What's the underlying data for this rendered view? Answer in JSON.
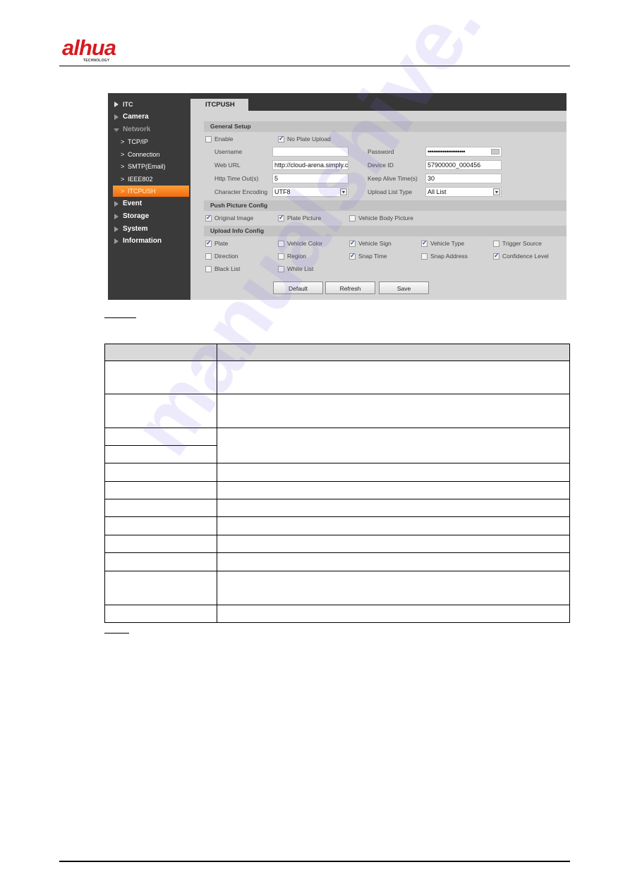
{
  "header": {
    "brand": "alhua",
    "tagline": "TECHNOLOGY",
    "brand_color": "#d7191f"
  },
  "screenshot": {
    "sidebar": {
      "items": [
        {
          "label": "ITC",
          "icon": "triangle-right-icon"
        },
        {
          "label": "Camera",
          "icon": "triangle-right-icon"
        },
        {
          "label": "Network",
          "icon": "triangle-down-icon",
          "expanded": true
        },
        {
          "label": "Event",
          "icon": "triangle-right-icon"
        },
        {
          "label": "Storage",
          "icon": "triangle-right-icon"
        },
        {
          "label": "System",
          "icon": "triangle-right-icon"
        },
        {
          "label": "Information",
          "icon": "triangle-right-icon"
        }
      ],
      "network_children": [
        {
          "label": "TCP/IP",
          "icon": "chevron-right-icon"
        },
        {
          "label": "Connection",
          "icon": "chevron-right-icon"
        },
        {
          "label": "SMTP(Email)",
          "icon": "chevron-right-icon"
        },
        {
          "label": "IEEE802",
          "icon": "chevron-right-icon"
        },
        {
          "label": "ITCPUSH",
          "icon": "chevron-right-icon",
          "active": true
        }
      ],
      "active_color": "#f58220"
    },
    "tab": "ITCPUSH",
    "general": {
      "title": "General Setup",
      "enable": {
        "label": "Enable",
        "checked": false
      },
      "no_plate_upload": {
        "label": "No Plate Upload",
        "checked": true
      },
      "username": {
        "label": "Username",
        "value": ""
      },
      "password": {
        "label": "Password",
        "value": "••••••••••••••••••••"
      },
      "web_url": {
        "label": "Web URL",
        "value": "http://cloud-arena.simply.c"
      },
      "device_id": {
        "label": "Device ID",
        "value": "57900000_000456"
      },
      "http_timeout": {
        "label": "Http Time Out(s)",
        "value": "5"
      },
      "keep_alive": {
        "label": "Keep Alive Time(s)",
        "value": "30"
      },
      "char_encoding": {
        "label": "Character Encoding",
        "value": "UTF8"
      },
      "upload_list_type": {
        "label": "Upload List Type",
        "value": "All List"
      }
    },
    "push_picture": {
      "title": "Push Picture Config",
      "items": [
        {
          "label": "Original Image",
          "checked": true
        },
        {
          "label": "Plate Picture",
          "checked": true
        },
        {
          "label": "Vehicle Body Picture",
          "checked": false
        }
      ]
    },
    "upload_info": {
      "title": "Upload Info Config",
      "items": [
        {
          "label": "Plate",
          "checked": true
        },
        {
          "label": "Vehicle Color",
          "checked": false
        },
        {
          "label": "Vehicle Sign",
          "checked": true
        },
        {
          "label": "Vehicle Type",
          "checked": true
        },
        {
          "label": "Trigger Source",
          "checked": false
        },
        {
          "label": "Direction",
          "checked": false
        },
        {
          "label": "Region",
          "checked": false
        },
        {
          "label": "Snap Time",
          "checked": true
        },
        {
          "label": "Snap Address",
          "checked": false
        },
        {
          "label": "Confidence Level",
          "checked": true
        },
        {
          "label": "Black List",
          "checked": false
        },
        {
          "label": "White List",
          "checked": false
        }
      ]
    },
    "buttons": {
      "default": "Default",
      "refresh": "Refresh",
      "save": "Save"
    }
  },
  "doc_table": {
    "header": [
      "",
      ""
    ],
    "rows": [
      [
        "",
        ""
      ],
      [
        "",
        ""
      ],
      [
        "",
        ""
      ],
      [
        "",
        ""
      ],
      [
        "",
        ""
      ],
      [
        "",
        ""
      ],
      [
        "",
        ""
      ],
      [
        "",
        ""
      ],
      [
        "",
        ""
      ],
      [
        "",
        ""
      ],
      [
        "",
        ""
      ],
      [
        "",
        ""
      ]
    ]
  },
  "watermark": "manualshive."
}
